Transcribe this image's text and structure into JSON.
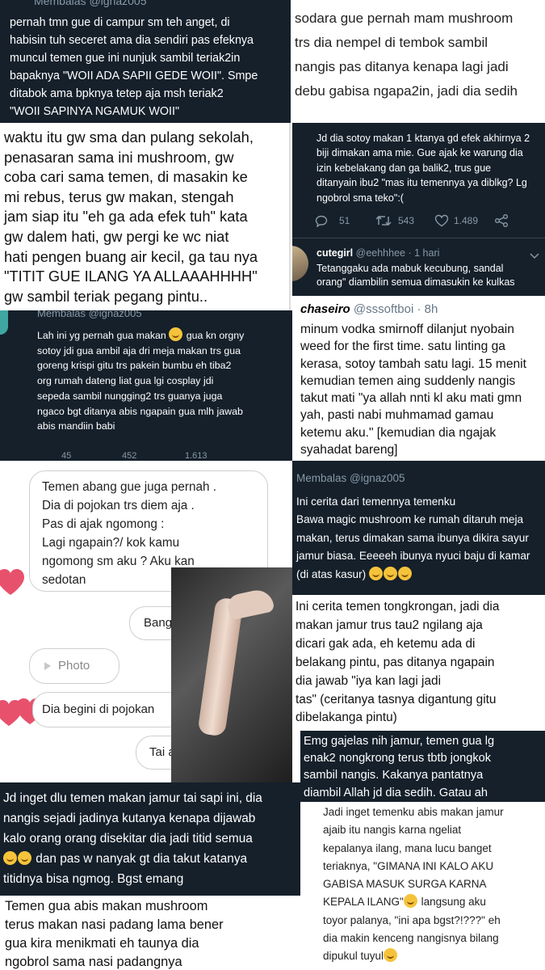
{
  "p1": {
    "reply_label": "Membalas @ignaz005",
    "text": "pernah tmn gue di campur sm teh anget, di\nhabisin tuh seceret ama dia sendiri pas efeknya\nmuncul temen gue ini nunjuk sambil teriak2in\nbapaknya \"WOII ADA SAPII GEDE WOII\". Smpe\nditabok ama bpknya tetep aja msh teriak2\n\"WOII SAPINYA NGAMUK WOII\""
  },
  "p2": {
    "text": "sodara gue pernah mam mushroom\ntrs dia nempel di tembok sambil\nnangis pas ditanya kenapa lagi jadi\ndebu gabisa ngapa2in, jadi dia sedih"
  },
  "p3": {
    "text": "waktu itu gw sma dan pulang sekolah,\npenasaran sama ini mushroom, gw\ncoba cari sama temen, di masakin ke\nmi rebus, terus gw makan, stengah\njam siap itu \"eh ga ada efek tuh\" kata\ngw dalem hati, gw pergi ke wc niat\nhati pengen buang air kecil, ga tau nya\n\"TITIT GUE ILANG YA ALLAAAHHHH\"\ngw sambil teriak pegang pintu.."
  },
  "p4": {
    "text": "Jd dia sotoy makan 1 ktanya gd efek akhirnya 2\nbiji dimakan ama mie. Gue ajak ke warung dia\nizin kebelakang dan ga balik2, trus gue\nditanyain ibu2 \"mas itu temennya ya diblkg? Lg\nngobrol sma teko\":(",
    "replies": "51",
    "retweets": "543",
    "likes": "1.489",
    "reply_user": "cutegirl",
    "reply_handle": "@eehhhee",
    "reply_time": "· 1 hari",
    "reply_text": "Tetanggaku ada mabuk kecubung, sandal\norang\" diambilin semua dimasukin ke kulkas"
  },
  "p5": {
    "reply_label": "Membalas @ignaz005",
    "text": "Lah ini yg pernah gua makan ",
    "text_after_emoji": " gua kn orgny\nsotoy jdi gua ambil aja dri meja makan trs gua\ngoreng krispi gitu trs pakein bumbu eh tiba2\norg rumah dateng liat gua lgi cosplay jdi\nsepeda sambil nungging2 trs guanya juga\nngaco bgt ditanya abis ngapain gua mlh jawab\nabis mandiin babi",
    "replies": "45",
    "retweets": "452",
    "likes": "1.613"
  },
  "p6": {
    "user": "chaseiro",
    "handle": "@sssoftboi",
    "time": "· 8h",
    "text": "minum vodka smirnoff dilanjut nyobain\nweed for the first time. satu linting ga\nkerasa, sotoy tambah satu lagi. 15 menit\nkemudian temen aing suddenly nangis\ntakut mati \"ya allah nnti kl aku mati gmn\nyah, pasti nabi muhmamad gamau\nketemu aku.\" [kemudian dia ngajak\nsyahadat bareng]"
  },
  "p7": {
    "bubble_text": "Temen abang gue juga pernah .\nDia di pojokan trs diem aja .\nPas di ajak ngomong :\nLagi ngapain?/ kok kamu\nngomong sm aku ? Aku kan\nsedotan",
    "bang": "Bang",
    "photo": "Photo",
    "pojokan": "Dia begini di pojokan",
    "tai": "Tai a"
  },
  "p8": {
    "reply_label": "Membalas @ignaz005",
    "text": "Ini cerita dari temennya temenku\nBawa magic mushroom ke rumah ditaruh meja\nmakan, terus dimakan sama ibunya dikira sayur\njamur biasa. Eeeeeh ibunya nyuci baju di kamar\n(di atas kasur) "
  },
  "p9": {
    "text": "Ini cerita temen tongkrongan, jadi dia\nmakan jamur trus tau2 ngilang aja\ndicari gak ada, eh ketemu ada di\nbelakang pintu, pas ditanya ngapain\ndia jawab \"iya kan lagi jadi\ntas\" (ceritanya tasnya digantung gitu\ndibelakanga pintu)"
  },
  "p10": {
    "text": "Emg gajelas nih jamur, temen gua lg\nenak2 nongkrong terus tbtb jongkok\nsambil nangis. Kakanya pantatnya\ndiambil Allah jd dia sedih. Gatau ah"
  },
  "p11": {
    "text": "Jd inget dlu temen makan jamur tai sapi ini, dia\nnangis sejadi jadinya kutanya kenapa dijawab\nkalo orang orang disekitar dia jadi titid semua",
    "text2": " dan pas w nanyak gt dia takut katanya\ntitidnya bisa ngmog. Bgst emang"
  },
  "p12": {
    "text": "Jadi inget temenku abis makan jamur\najaib itu nangis karna ngeliat\nkepalanya ilang, mana lucu banget\nteriaknya, \"GIMANA INI KALO AKU\nGABISA MASUK SURGA KARNA\nKEPALA ILANG\"",
    "text2": " langsung aku\ntoyor palanya, \"ini apa bgst?!???\" eh\ndia makin kenceng nangisnya bilang\ndipukul tuyul"
  },
  "p13": {
    "text": "Temen gua abis makan mushroom\nterus makan nasi padang lama bener\ngua kira menikmati eh taunya dia\nngobrol sama nasi padangnya"
  },
  "colors": {
    "dark_bg": "#15202b",
    "dim_text": "#8899a6",
    "link_blue": "#1da1f2",
    "heart_pink": "#e8516c"
  },
  "icons": [
    "reply-icon",
    "retweet-icon",
    "like-icon",
    "share-icon",
    "heart-icon",
    "chevron-down-icon",
    "avatar",
    "emoji-icon",
    "photo-icon"
  ]
}
